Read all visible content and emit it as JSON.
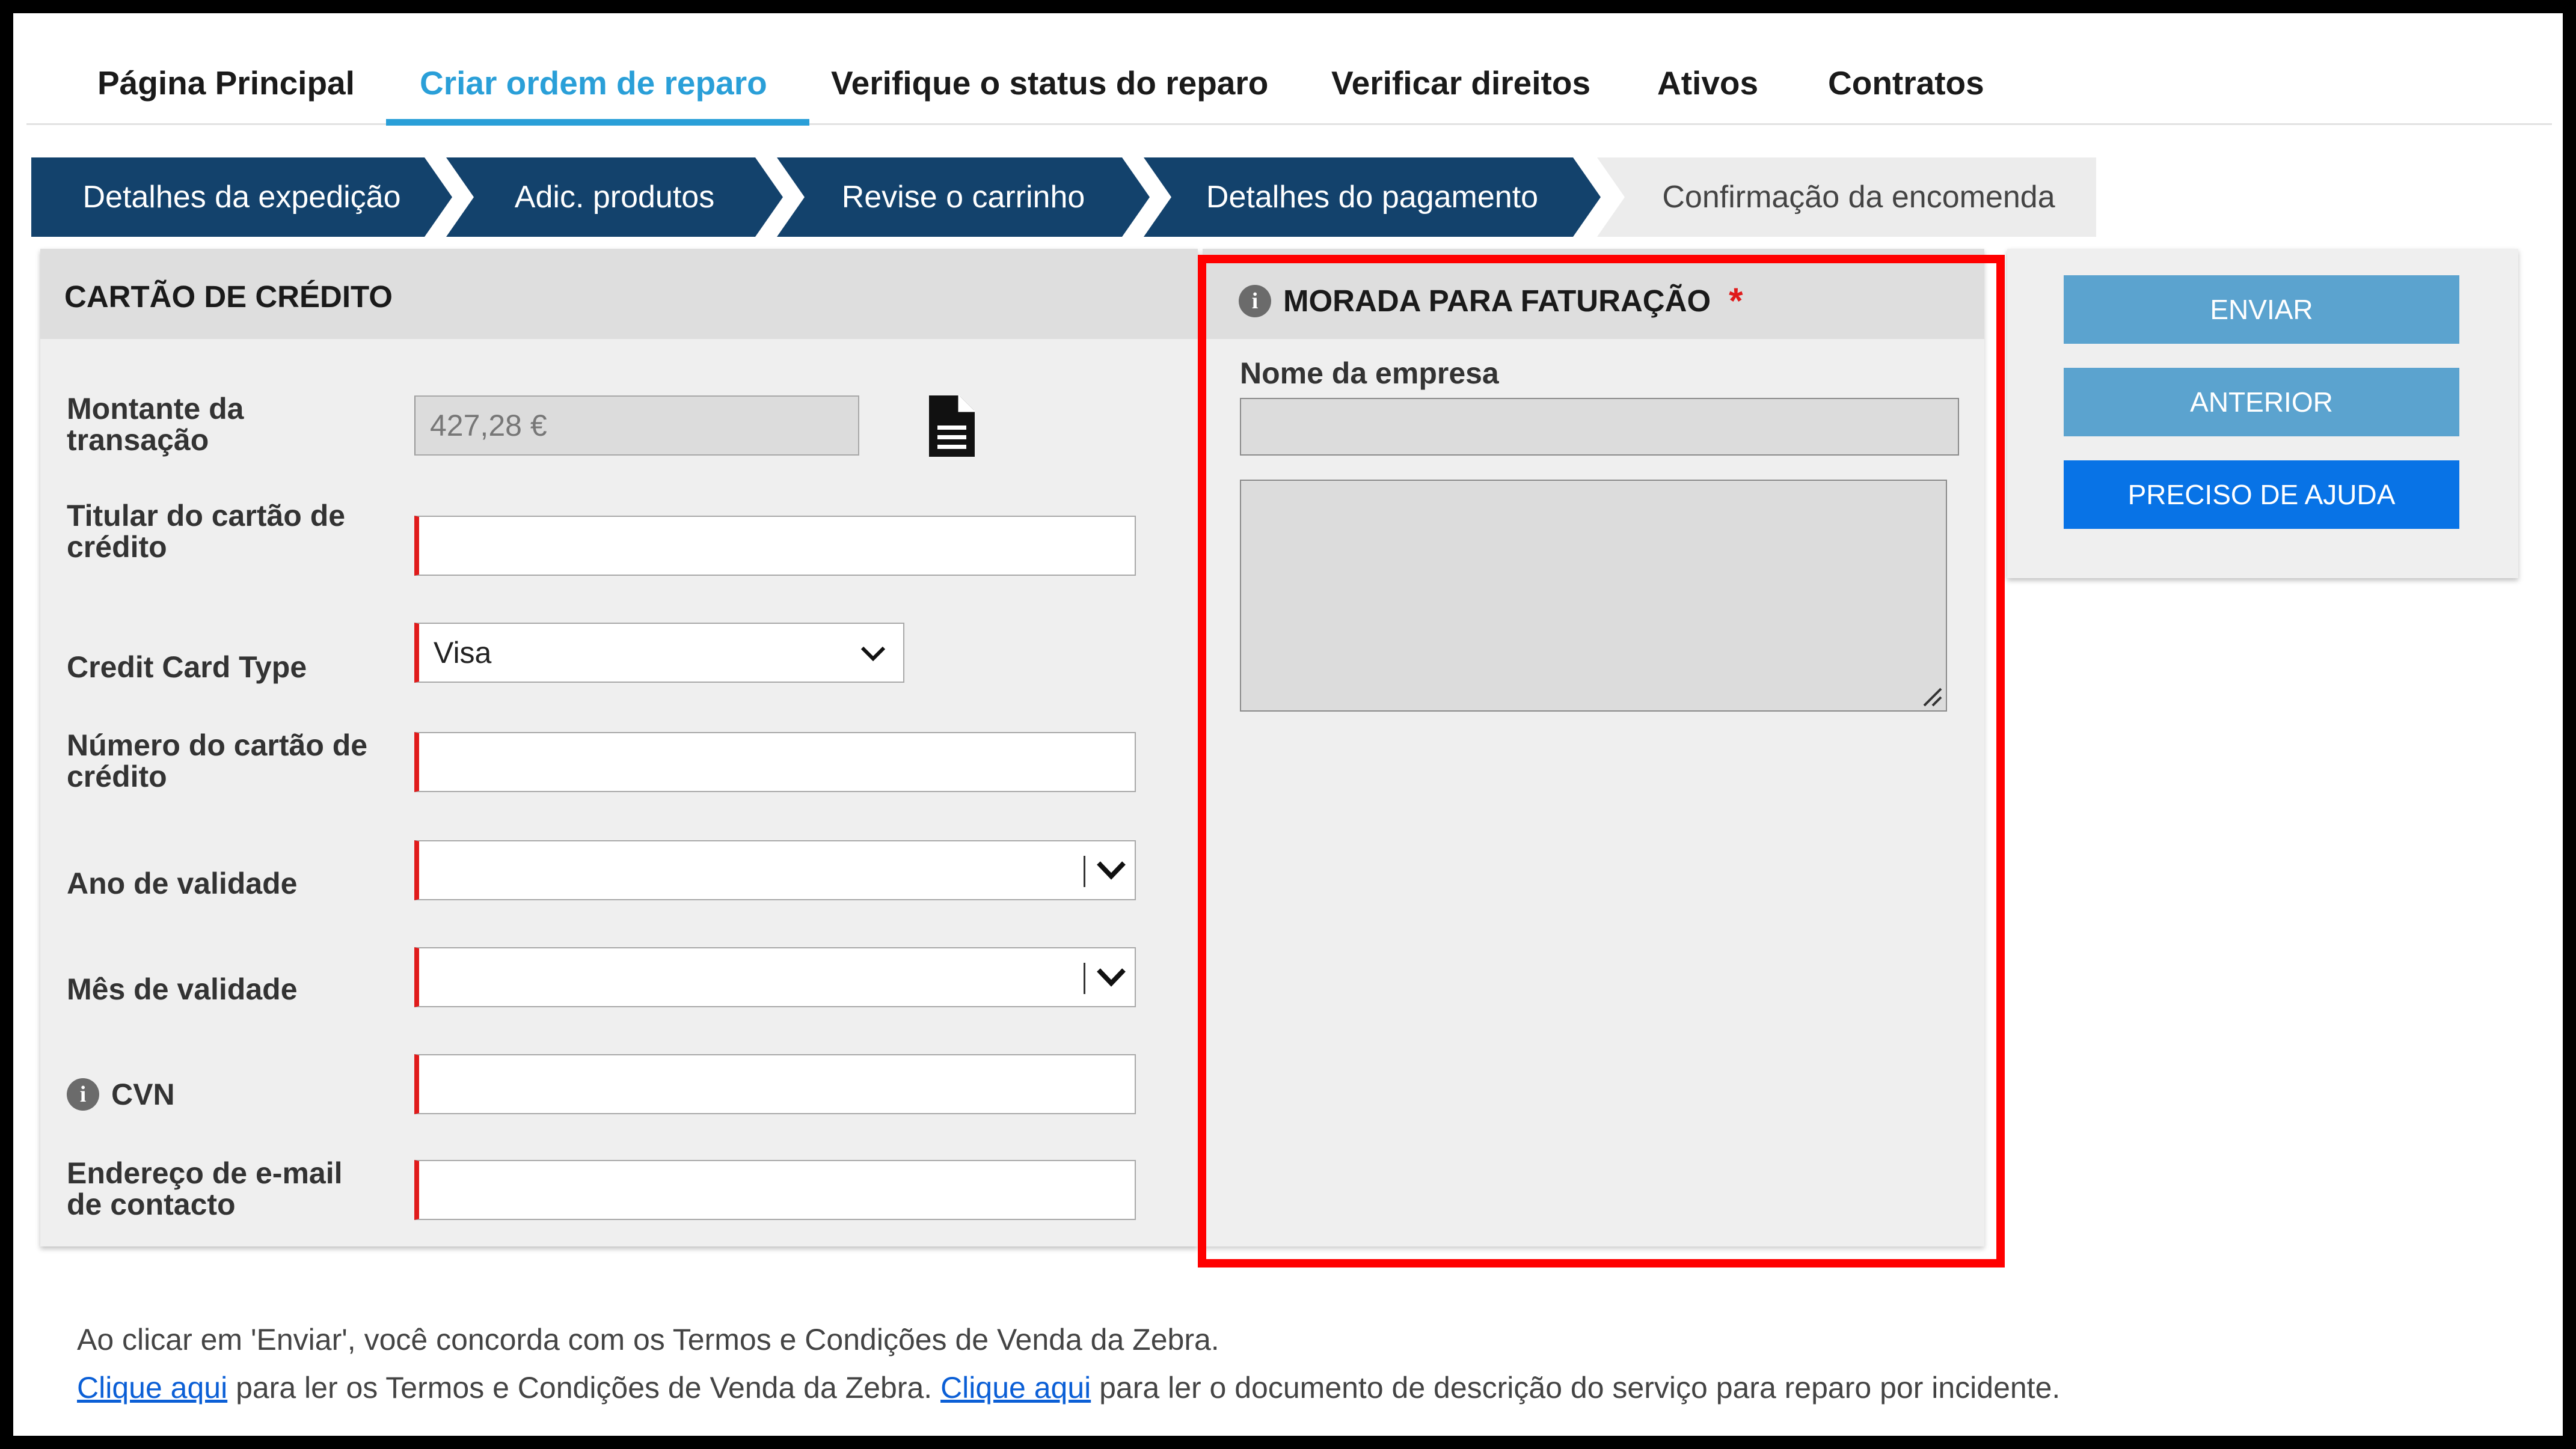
{
  "nav": {
    "tabs": [
      {
        "label": "Página Principal"
      },
      {
        "label": "Criar ordem de reparo"
      },
      {
        "label": "Verifique o status do reparo"
      },
      {
        "label": "Verificar direitos"
      },
      {
        "label": "Ativos"
      },
      {
        "label": "Contratos"
      }
    ],
    "active_index": 1
  },
  "steps": [
    {
      "label": "Detalhes da expedição"
    },
    {
      "label": "Adic. produtos"
    },
    {
      "label": "Revise o carrinho"
    },
    {
      "label": "Detalhes do pagamento"
    },
    {
      "label": "Confirmação da encomenda"
    }
  ],
  "credit_card": {
    "title": "CARTÃO DE CRÉDITO",
    "amount_label_1": "Montante da",
    "amount_label_2": "transação",
    "amount_value": "427,28 €",
    "holder_label_1": "Titular do cartão de",
    "holder_label_2": "crédito",
    "holder_value": "",
    "type_label": "Credit Card Type",
    "type_value": "Visa",
    "number_label_1": "Número do cartão de",
    "number_label_2": "crédito",
    "number_value": "",
    "year_label": "Ano de validade",
    "year_value": "",
    "month_label": "Mês de validade",
    "month_value": "",
    "cvn_label": "CVN",
    "cvn_value": "",
    "email_label_1": "Endereço de e-mail",
    "email_label_2": "de contacto",
    "email_value": ""
  },
  "billing": {
    "title": "MORADA PARA FATURAÇÃO",
    "required_mark": "*",
    "company_label": "Nome da empresa",
    "company_value": "",
    "address_value": ""
  },
  "actions": {
    "submit": "ENVIAR",
    "previous": "ANTERIOR",
    "help": "PRECISO DE AJUDA"
  },
  "footer": {
    "agree_text": "Ao clicar em 'Enviar', você concorda com os Termos e Condições de Venda da Zebra.",
    "link1": "Clique aqui",
    "text1": " para ler os Termos e Condições de Venda da Zebra. ",
    "link2": "Clique aqui",
    "text2": " para ler o documento de descrição do serviço para reparo por incidente."
  },
  "colors": {
    "nav_active": "#2a9fd8",
    "step_bg": "#13426c",
    "required_border": "#e01b1b",
    "highlight_box": "#ff0000",
    "button_muted": "#5ba3cf",
    "button_primary": "#0873e6"
  },
  "icons": {
    "document": "document-icon",
    "info": "info-icon",
    "chevron": "chevron-down-icon"
  }
}
